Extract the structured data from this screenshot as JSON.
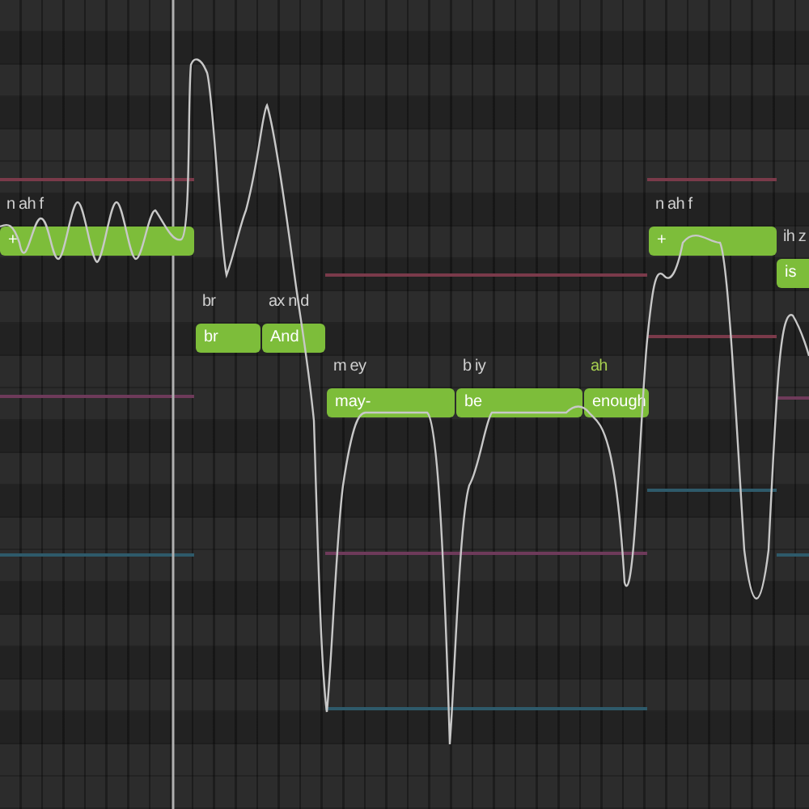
{
  "notes": [
    {
      "lyric": "+",
      "phonemes": "n ah f",
      "phoneme_highlighted": false
    },
    {
      "lyric": "br",
      "phonemes": "br",
      "phoneme_highlighted": false
    },
    {
      "lyric": "And",
      "phonemes": "ax n d",
      "phoneme_highlighted": false
    },
    {
      "lyric": "may-",
      "phonemes": "m ey",
      "phoneme_highlighted": false
    },
    {
      "lyric": "be",
      "phonemes": "b iy",
      "phoneme_highlighted": false
    },
    {
      "lyric": "enough",
      "phonemes": "ah",
      "phoneme_highlighted": true
    },
    {
      "lyric": "+",
      "phonemes": "n ah f",
      "phoneme_highlighted": false
    },
    {
      "lyric": "is",
      "phonemes": "ih z",
      "phoneme_highlighted": false
    }
  ]
}
